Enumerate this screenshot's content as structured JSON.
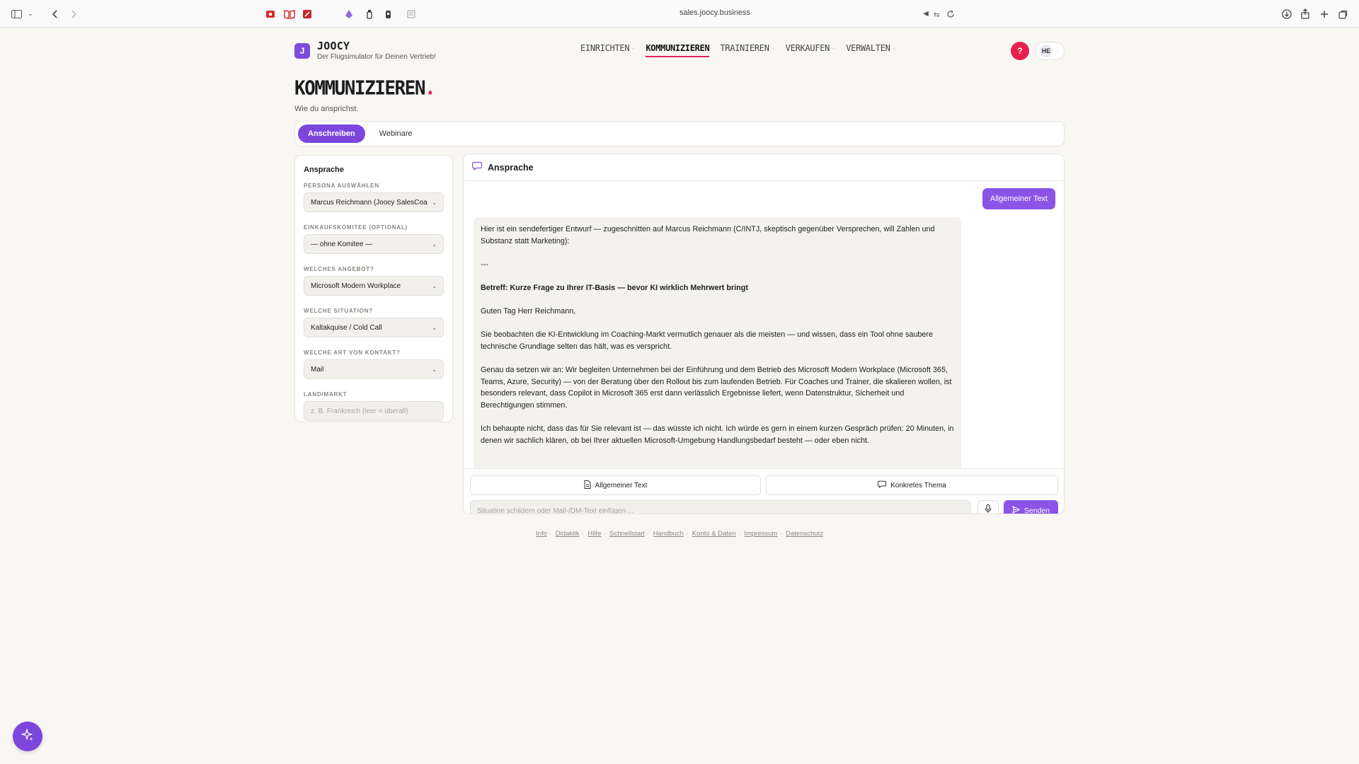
{
  "browser": {
    "url": "sales.joocy.business"
  },
  "app": {
    "logo_letter": "J",
    "brand": "JOOCY",
    "tagline": "Der Flugsimulator für Deinen Vertrieb!",
    "help_label": "?",
    "user_initials": "HE"
  },
  "nav": {
    "items": [
      {
        "label": "EINRICHTEN",
        "active": false
      },
      {
        "label": "KOMMUNIZIEREN",
        "active": true
      },
      {
        "label": "TRAINIEREN",
        "active": false
      },
      {
        "label": "VERKAUFEN",
        "active": false
      },
      {
        "label": "VERWALTEN",
        "active": false
      }
    ]
  },
  "page": {
    "title": "KOMMUNIZIEREN",
    "title_accent": ".",
    "subtitle": "Wie du ansprichst."
  },
  "tabs": [
    {
      "label": "Anschreiben",
      "active": true
    },
    {
      "label": "Webinare",
      "active": false
    }
  ],
  "form": {
    "heading": "Ansprache",
    "persona": {
      "label": "PERSONA AUSWÄHLEN",
      "value": "Marcus Reichmann (Joocy SalesCoa"
    },
    "committee": {
      "label": "EINKAUFSKOMITEE (OPTIONAL)",
      "value": "— ohne Komitee —"
    },
    "offer": {
      "label": "WELCHES ANGEBOT?",
      "value": "Microsoft Modern Workplace"
    },
    "situation": {
      "label": "WELCHE SITUATION?",
      "value": "Kaltakquise / Cold Call"
    },
    "contact": {
      "label": "WELCHE ART VON KONTAKT?",
      "value": "Mail"
    },
    "market": {
      "label": "LAND/MARKT",
      "placeholder": "z. B. Frankreich (leer = überall)"
    }
  },
  "chat": {
    "title": "Ansprache",
    "user_message": "Allgemeiner Text",
    "ai_message": {
      "p1": "Hier ist ein sendefertiger Entwurf — zugeschnitten auf Marcus Reichmann (C/INTJ, skeptisch gegenüber Versprechen, will Zahlen und Substanz statt Marketing):",
      "p2": "---",
      "p3": "Betreff: Kurze Frage zu Ihrer IT-Basis — bevor KI wirklich Mehrwert bringt",
      "p4": "Guten Tag Herr Reichmann,",
      "p5": "Sie beobachten die KI-Entwicklung im Coaching-Markt vermutlich genauer als die meisten — und wissen, dass ein Tool ohne saubere technische Grundlage selten das hält, was es verspricht.",
      "p6": "Genau da setzen wir an: Wir begleiten Unternehmen bei der Einführung und dem Betrieb des Microsoft Modern Workplace (Microsoft 365, Teams, Azure, Security) — von der Beratung über den Rollout bis zum laufenden Betrieb. Für Coaches und Trainer, die skalieren wollen, ist besonders relevant, dass Copilot in Microsoft 365 erst dann verlässlich Ergebnisse liefert, wenn Datenstruktur, Sicherheit und Berechtigungen stimmen.",
      "p7": "Ich behaupte nicht, dass das für Sie relevant ist — das wüsste ich nicht. Ich würde es gern in einem kurzen Gespräch prüfen: 20 Minuten, in denen wir sachlich klären, ob bei Ihrer aktuellen Microsoft-Umgebung Handlungsbedarf besteht — oder eben nicht."
    },
    "quick_general": "Allgemeiner Text",
    "quick_topic": "Konkretes Thema",
    "input_placeholder": "Situation schildern oder Mail-/DM-Text einfügen ...",
    "send_label": "Senden"
  },
  "footer": {
    "links": [
      "Info",
      "Didaktik",
      "Hilfe",
      "Schnellstart",
      "Handbuch",
      "Konto & Daten",
      "Impressum",
      "Datenschutz"
    ],
    "separator": "·"
  },
  "colors": {
    "accent": "#7c46dd",
    "accent_light": "#8b54e6",
    "nav_underline": "#e0245e",
    "help": "#e8204d"
  }
}
